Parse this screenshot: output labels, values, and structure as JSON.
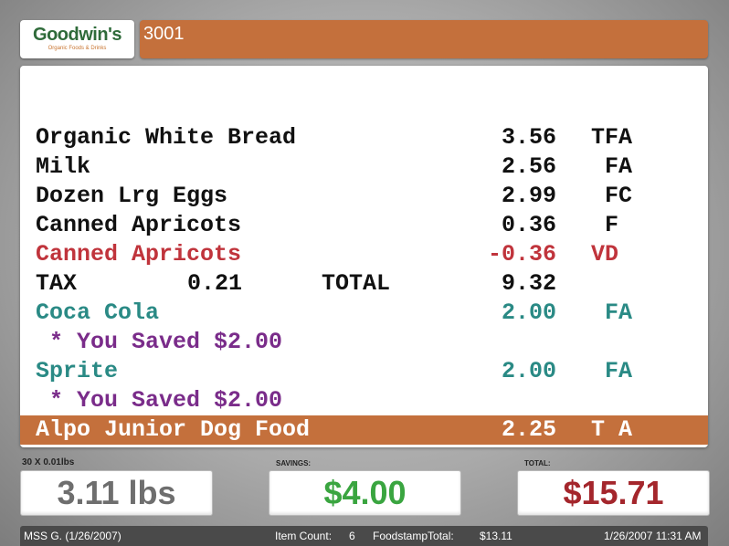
{
  "brand": {
    "name": "Goodwin's",
    "tagline": "Organic Foods & Drinks"
  },
  "header": {
    "title": "3001"
  },
  "receipt": {
    "items": [
      {
        "desc": "Organic White Bread",
        "amount": "3.56",
        "code": "TFA"
      },
      {
        "desc": "Milk",
        "amount": "2.56",
        "code": " FA"
      },
      {
        "desc": "Dozen Lrg Eggs",
        "amount": "2.99",
        "code": " FC"
      },
      {
        "desc": "Canned Apricots",
        "amount": "0.36",
        "code": " F"
      },
      {
        "desc": "Canned Apricots",
        "amount": "-0.36",
        "code": "VD"
      }
    ],
    "tax_line": {
      "tax_label": "TAX",
      "tax_value": "0.21",
      "total_label": "TOTAL",
      "total_value": "9.32"
    },
    "items2": [
      {
        "desc": "Coca Cola",
        "amount": "2.00",
        "code": " FA"
      },
      {
        "savings": " * You Saved $2.00"
      },
      {
        "desc": "Sprite",
        "amount": "2.00",
        "code": " FA"
      },
      {
        "savings": " * You Saved $2.00"
      },
      {
        "desc": "Alpo Junior Dog Food",
        "amount": "2.25",
        "code": "T A"
      }
    ]
  },
  "summary": {
    "weight_label": "30 X 0.01lbs",
    "weight_value": "3.11 lbs",
    "savings_label": "SAVINGS:",
    "savings_value": "$4.00",
    "total_label": "TOTAL:",
    "total_value": "$15.71"
  },
  "status": {
    "cashier": "MSS G. (1/26/2007)",
    "item_count_label": "Item Count:",
    "item_count": "6",
    "foodstamp_label": "FoodstampTotal:",
    "foodstamp_value": "$13.11",
    "datetime": "1/26/2007 11:31 AM"
  },
  "colors": {
    "accent": "#c4703c",
    "savings_green": "#3aa540",
    "total_red": "#a4262c",
    "weight_gray": "#6e6e6e",
    "void_red": "#c0343c",
    "promo_teal": "#2a8a85",
    "saved_purple": "#7a2c8a"
  }
}
